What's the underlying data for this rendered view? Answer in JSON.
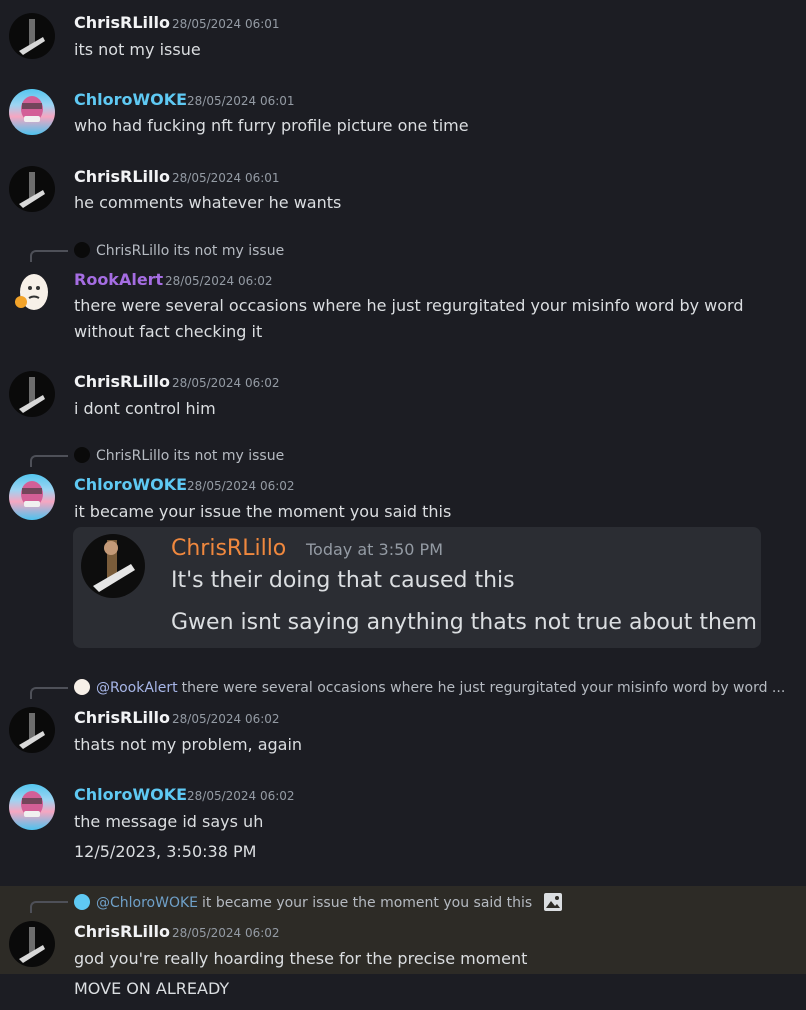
{
  "colors": {
    "chris": "#f2f3f5",
    "chloro": "#5fc9f3",
    "rook": "#a56de2",
    "embed_name": "#f0883e"
  },
  "messages": [
    {
      "author": "ChrisRLillo",
      "timestamp": "28/05/2024 06:01",
      "lines": [
        "its not my issue"
      ]
    },
    {
      "author": "ChloroWOKE",
      "timestamp": "28/05/2024 06:01",
      "lines": [
        "who had fucking nft furry profile picture one time"
      ]
    },
    {
      "author": "ChrisRLillo",
      "timestamp": "28/05/2024 06:01",
      "lines": [
        "he comments whatever he wants"
      ]
    },
    {
      "reply_author": "ChrisRLillo",
      "reply_text": "its not my issue",
      "author": "RookAlert",
      "timestamp": "28/05/2024 06:02",
      "lines": [
        "there were several occasions where he just regurgitated your misinfo word by word",
        "without fact checking it"
      ]
    },
    {
      "author": "ChrisRLillo",
      "timestamp": "28/05/2024 06:02",
      "lines": [
        "i dont control him"
      ]
    },
    {
      "reply_author": "ChrisRLillo",
      "reply_text": "its not my issue",
      "author": "ChloroWOKE",
      "timestamp": "28/05/2024 06:02",
      "lines": [
        "it became your issue the moment you said this"
      ]
    },
    {
      "reply_author": "@RookAlert",
      "reply_text": "there were several occasions where he just regurgitated your misinfo word by word ...",
      "author": "ChrisRLillo",
      "timestamp": "28/05/2024 06:02",
      "lines": [
        "thats not my problem, again"
      ]
    },
    {
      "author": "ChloroWOKE",
      "timestamp": "28/05/2024 06:02",
      "lines": [
        "the message id says uh",
        "12/5/2023, 3:50:38 PM"
      ]
    },
    {
      "reply_author": "@ChloroWOKE",
      "reply_text": "it became your issue the moment you said this",
      "author": "ChrisRLillo",
      "timestamp": "28/05/2024 06:02",
      "lines": [
        "god you're really hoarding these for the precise moment",
        "MOVE ON ALREADY"
      ]
    }
  ],
  "embed": {
    "author": "ChrisRLillo",
    "timestamp": "Today at 3:50 PM",
    "lines": [
      "It's their doing that caused this",
      "Gwen isnt saying anything thats not true about them"
    ]
  },
  "icons": {
    "reply_image_icon": "image-icon"
  }
}
